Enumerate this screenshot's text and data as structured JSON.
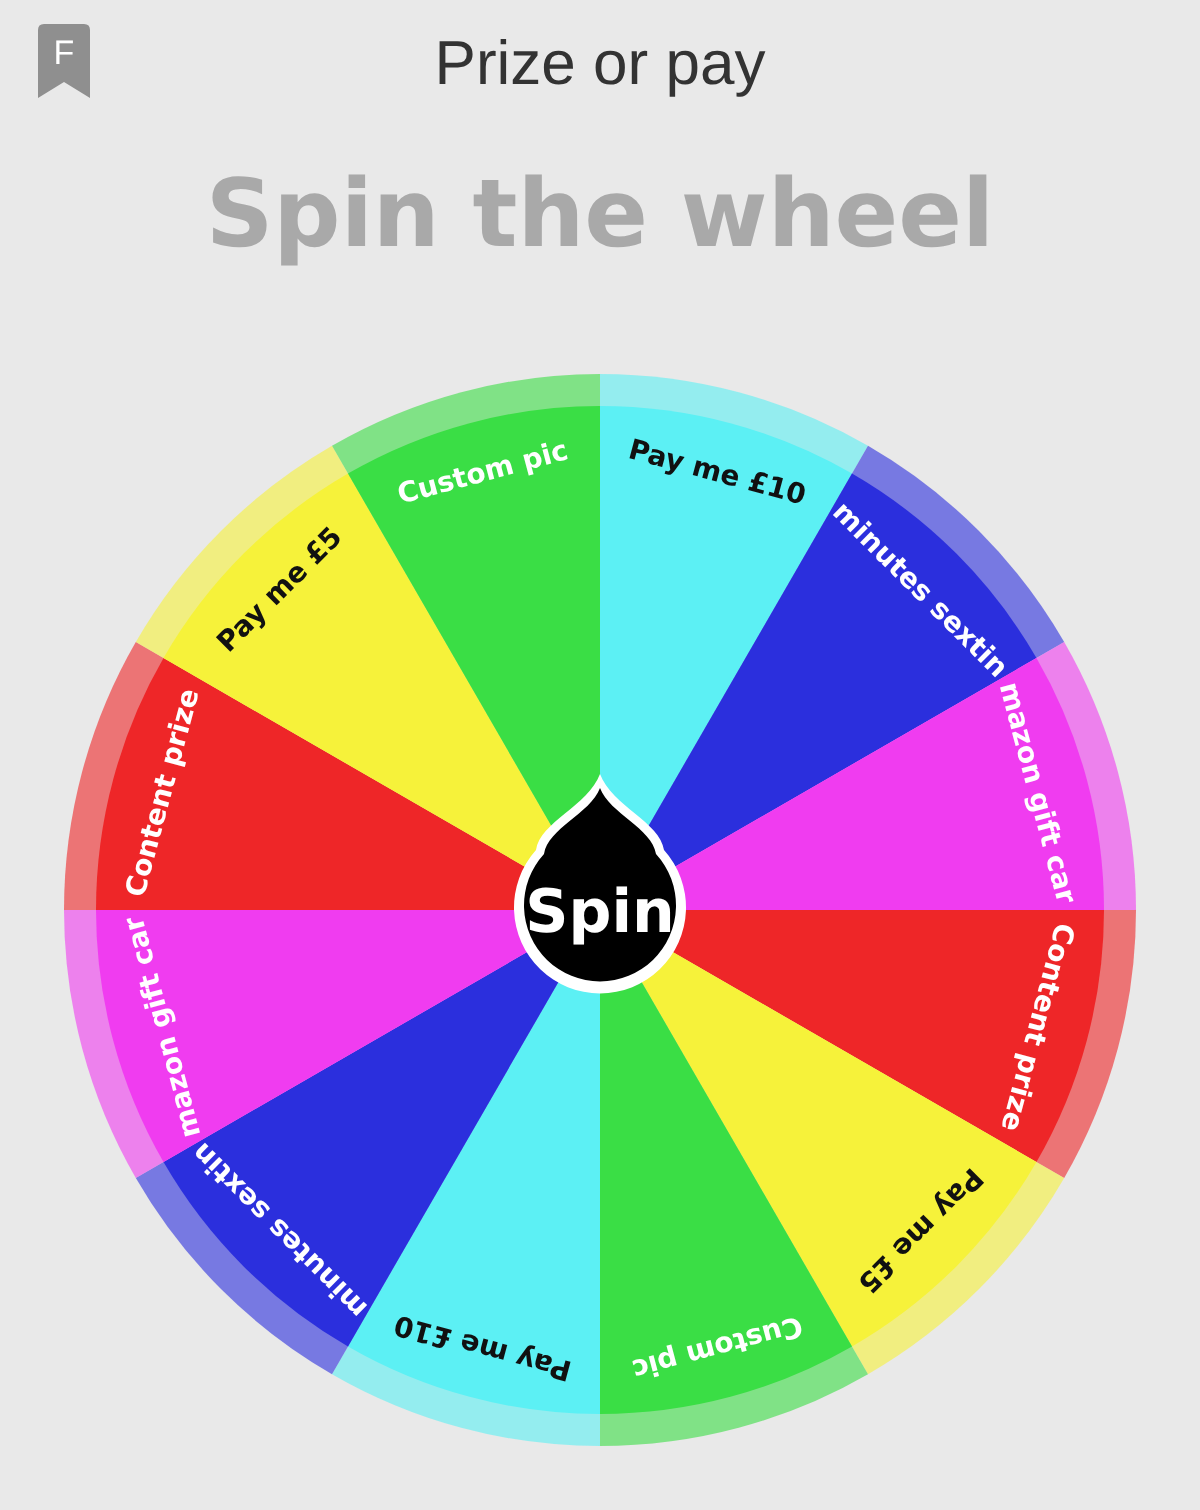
{
  "header": {
    "app_badge": "F",
    "title": "Prize or pay"
  },
  "heading": "Spin the wheel",
  "wheel": {
    "segments": [
      {
        "label": "Pay me £10",
        "color": "#5cf0f4"
      },
      {
        "label": "minutes sextin",
        "color": "#2b2fdd"
      },
      {
        "label": "mazon gift car",
        "color": "#f03cf0"
      },
      {
        "label": "Content prize",
        "color": "#ee2628"
      },
      {
        "label": "Pay me £5",
        "color": "#f6f23a"
      },
      {
        "label": "Custom pic",
        "color": "#3ade45"
      },
      {
        "label": "Pay me £10",
        "color": "#5cf0f4"
      },
      {
        "label": "minutes sextin",
        "color": "#2b2fdd"
      },
      {
        "label": "mazon gift car",
        "color": "#f03cf0"
      },
      {
        "label": "Content prize",
        "color": "#ee2628"
      },
      {
        "label": "Pay me £5",
        "color": "#f6f23a"
      },
      {
        "label": "Custom pic",
        "color": "#3ade45"
      }
    ],
    "spin_button": "Spin"
  }
}
